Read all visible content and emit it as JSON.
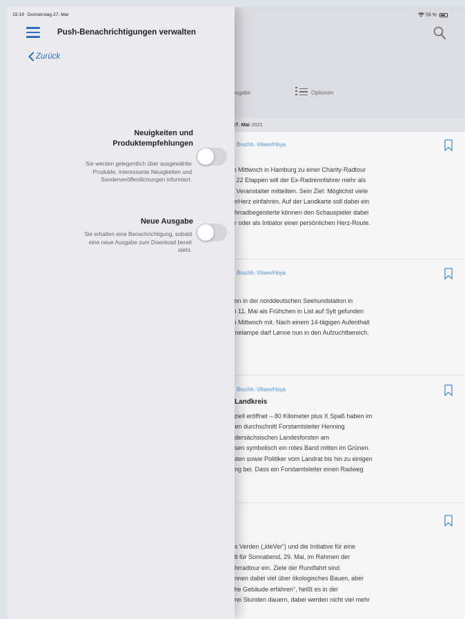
{
  "status_bar": {
    "time": "15:19",
    "date": "Donnerstag 27. Mai",
    "battery": "59 %"
  },
  "background": {
    "toolbar": {
      "ausgabe": "usgabe",
      "optionen": "Optionen"
    },
    "date_bar": {
      "day": "27. Mai",
      "year": "2021"
    },
    "articles": [
      {
        "source": "Bruchh.-Vilsen/Hoya",
        "title": "",
        "lines": [
          "m Mittwoch in Hamburg zu einer Charity-Radtour",
          "n 22 Etappen will der Ex-Radrennfahrer mehr als",
          "e Veranstalter mitteilten. Sein Ziel: Möglichst viele",
          "lerHerz einfahren. Auf der Landkarte soll dabei ein",
          "ahrradbegeisterte können den Schauspieler dabei",
          "er oder als Initiator einer persönlichen Herz-Route."
        ]
      },
      {
        "source": "Bruchh.-Vilsen/Hoya",
        "title": "",
        "lines": [
          "son in der norddeutschen Seehundstation in",
          "m 11. Mai als Frühchen in List auf Sylt gefunden",
          "m Mittwoch mit. Nach einem 14-tägigen Aufenthalt",
          "rmelampe darf Lønne nun in den Aufzuchtbereich."
        ]
      },
      {
        "source": "Bruchh.-Vilsen/Hoya",
        "title": "Landkreis",
        "lines": [
          "fiziell eröffnet – 80 Kilometer plus X Spaß haben im",
          "rten durchschnitt Forstamtsleiter Henning",
          "edersächsischen Landesforsten am",
          "usen symbolisch ein rotes Band mitten im Grünen.",
          "rsten sowie Politiker vom Landrat bis hin zu einigen",
          "ung bei. Dass ein Forstamtsleiter einen Radweg"
        ]
      },
      {
        "source": "",
        "title": "",
        "lines": [
          "es Verden („kleVer“) und die Initiative für eine",
          "idt für Sonnabend, 29. Mai, im Rahmen der",
          "ahrradtour ein. Ziele der Rundfahrt sind",
          "önnen dabei viel über ökologisches Bauen, aber",
          "che Gebäude erfahren“, heißt es in der",
          "drei Stunden dauern, dabei werden nicht viel mehr"
        ]
      }
    ]
  },
  "drawer": {
    "title": "Push-Benachrichtigungen verwalten",
    "back_label": "Zurück",
    "settings": [
      {
        "title_line1": "Neuigkeiten und",
        "title_line2": "Produktempfehlungen",
        "desc_line1": "Sie werden gelegentlich über ausgewählte",
        "desc_line2": "Produkte, interessante Neuigkeiten und",
        "desc_line3": "Sonderveröffentlichungen informiert.",
        "enabled": false
      },
      {
        "title_line1": "Neue Ausgabe",
        "desc_line1": "Sie erhalten eine Benachrichtigung, sobald",
        "desc_line2": "eine neue Ausgabe zum Download bereit",
        "desc_line3": "steht.",
        "enabled": false
      }
    ]
  },
  "icons": {
    "menu": "hamburger-icon",
    "back": "chevron-left-icon",
    "search": "search-icon",
    "bookmark": "bookmark-icon",
    "options": "list-icon",
    "wifi": "wifi-icon",
    "battery": "battery-icon"
  },
  "colors": {
    "accent": "#2f6dbf",
    "link": "#4a8fd0",
    "toggle_off": "#d5d5da"
  }
}
